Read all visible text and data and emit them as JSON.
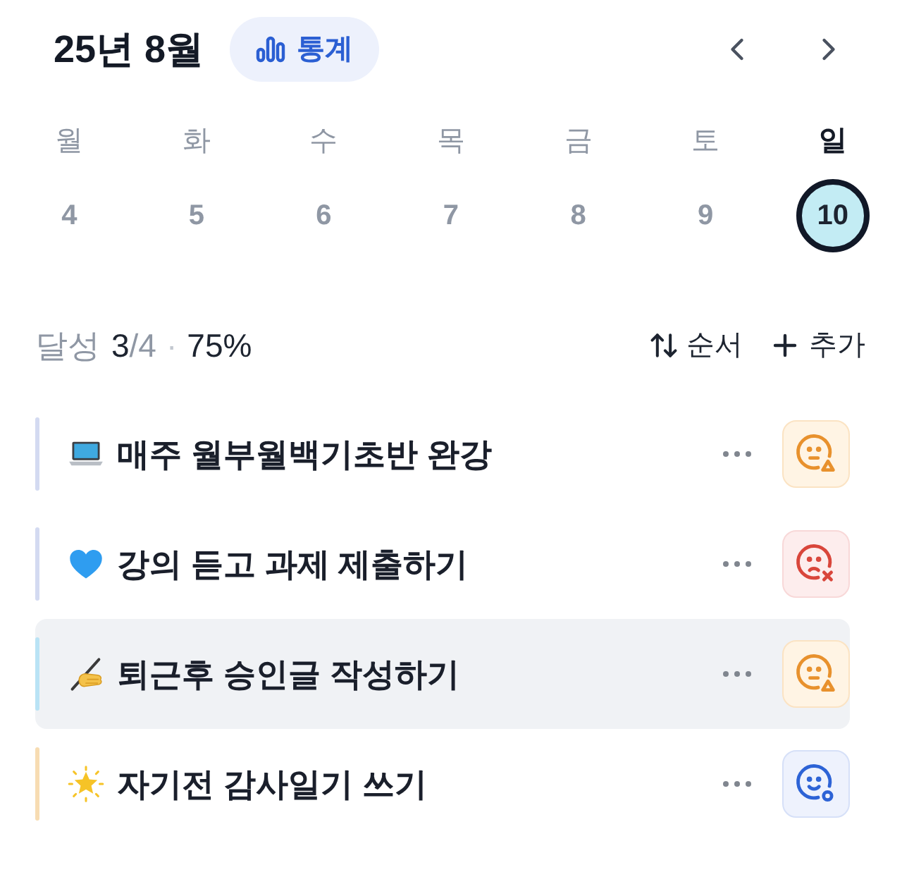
{
  "header": {
    "title": "25년 8월",
    "stats_button": "통계"
  },
  "week": [
    {
      "day": "월",
      "date": "4",
      "selected": false
    },
    {
      "day": "화",
      "date": "5",
      "selected": false
    },
    {
      "day": "수",
      "date": "6",
      "selected": false
    },
    {
      "day": "목",
      "date": "7",
      "selected": false
    },
    {
      "day": "금",
      "date": "8",
      "selected": false
    },
    {
      "day": "토",
      "date": "9",
      "selected": false
    },
    {
      "day": "일",
      "date": "10",
      "selected": true
    }
  ],
  "summary": {
    "label": "달성",
    "done": "3",
    "total": "/4",
    "separator": "·",
    "percent": "75%"
  },
  "actions": [
    {
      "kind": "sort",
      "label": "순서"
    },
    {
      "kind": "add",
      "label": "추가"
    }
  ],
  "tasks": [
    {
      "kind": "laptop",
      "title": "매주 월부월백기초반 완강",
      "color": "#d3daf1",
      "status": {
        "kind": "partial"
      },
      "selected": false
    },
    {
      "kind": "heart",
      "title": "강의 듣고 과제 제출하기",
      "color": "#d3daf1",
      "status": {
        "kind": "failed"
      },
      "selected": false
    },
    {
      "kind": "writing",
      "title": "퇴근후 승인글 작성하기",
      "color": "#b9e3f5",
      "status": {
        "kind": "partial"
      },
      "selected": true
    },
    {
      "kind": "star",
      "title": "자기전 감사일기 쓰기",
      "color": "#f7dcb2",
      "status": {
        "kind": "done"
      },
      "selected": false
    }
  ]
}
